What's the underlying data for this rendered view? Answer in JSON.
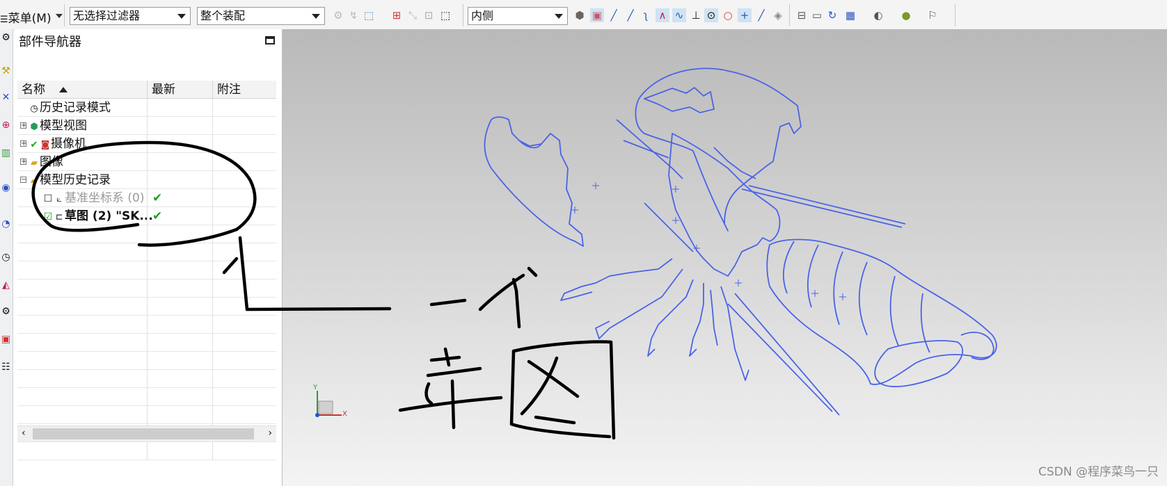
{
  "toolbar": {
    "menu_label": "菜单(M)",
    "filter_value": "无选择过滤器",
    "assembly_value": "整个装配",
    "mode_value": "内侧",
    "icons": [
      "snap-icon",
      "move-icon",
      "select-icon",
      "add-icon",
      "box-icon",
      "rect-icon",
      "cube-icon",
      "line-icon",
      "arc-icon",
      "spline-icon",
      "point-icon",
      "circle-icon",
      "cross-icon",
      "view-icon",
      "render-icon",
      "refresh-icon"
    ]
  },
  "navigator": {
    "title": "部件导航器",
    "columns": [
      "名称",
      "最新",
      "附注"
    ],
    "rows": [
      {
        "label": "历史记录模式",
        "icon": "clock-icon"
      },
      {
        "label": "模型视图",
        "icon": "view-icon"
      },
      {
        "label": "摄像机",
        "icon": "camera-icon"
      },
      {
        "label": "图像",
        "icon": "folder-icon"
      },
      {
        "label": "模型历史记录",
        "icon": "folder-icon"
      },
      {
        "label": "基准坐标系 (0)",
        "icon": "datum-icon",
        "latest": "✔"
      },
      {
        "label": "草图 (2) \"SK...",
        "icon": "sketch-icon",
        "latest": "✔"
      }
    ],
    "sort_direction": "ascending"
  },
  "annotation": {
    "text_line1": "一个",
    "text_line2": "草图"
  },
  "axis": {
    "y": "Y",
    "x": "X"
  },
  "watermark": "CSDN @程序菜鸟一只",
  "colors": {
    "sketch": "#4a63e6",
    "ink": "#000000",
    "check": "#19a319"
  }
}
